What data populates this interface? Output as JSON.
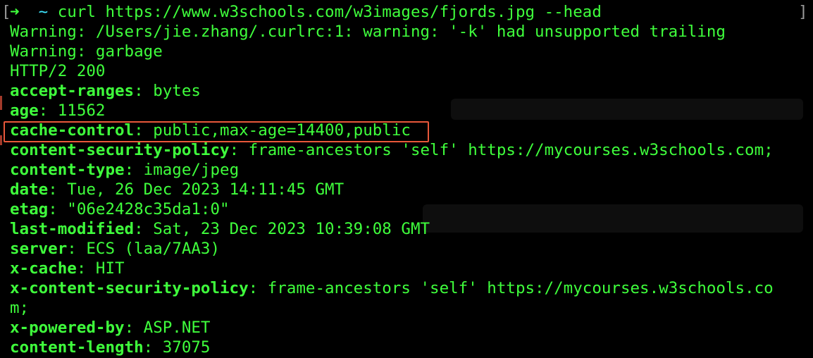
{
  "terminal": {
    "prompt": {
      "arrow": "➜",
      "tilde": "~",
      "command": "curl https://www.w3schools.com/w3images/fjords.jpg --head"
    },
    "brackets": {
      "left": "[",
      "right": "]"
    },
    "warnings": [
      "Warning: /Users/jie.zhang/.curlrc:1: warning: '-k' had unsupported trailing",
      "Warning: garbage"
    ],
    "status_line": "HTTP/2 200",
    "headers": [
      {
        "key": "accept-ranges",
        "sep": ": ",
        "value": "bytes"
      },
      {
        "key": "age",
        "sep": ": ",
        "value": "11562"
      },
      {
        "key": "cache-control",
        "sep": ": ",
        "value": "public,max-age=14400,public"
      },
      {
        "key": "content-security-policy",
        "sep": ": ",
        "value": "frame-ancestors 'self' https://mycourses.w3schools.com;"
      },
      {
        "key": "content-type",
        "sep": ": ",
        "value": "image/jpeg"
      },
      {
        "key": "date",
        "sep": ": ",
        "value": "Tue, 26 Dec 2023 14:11:45 GMT"
      },
      {
        "key": "etag",
        "sep": ": ",
        "value": "\"06e2428c35da1:0\""
      },
      {
        "key": "last-modified",
        "sep": ": ",
        "value": "Sat, 23 Dec 2023 10:39:08 GMT"
      },
      {
        "key": "server",
        "sep": ": ",
        "value": "ECS (laa/7AA3)"
      },
      {
        "key": "x-cache",
        "sep": ": ",
        "value": "HIT"
      },
      {
        "key": "x-content-security-policy",
        "sep": ": ",
        "value": "frame-ancestors 'self' https://mycourses.w3schools.co"
      }
    ],
    "wrapped_continuation": "m;",
    "trailing_headers": [
      {
        "key": "x-powered-by",
        "sep": ": ",
        "value": "ASP.NET"
      },
      {
        "key": "content-length",
        "sep": ": ",
        "value": "37075"
      }
    ]
  },
  "colors": {
    "text": "#3fff3c",
    "tilde": "#3fe6ff",
    "background": "#000000",
    "highlight_border": "#e8573a"
  }
}
